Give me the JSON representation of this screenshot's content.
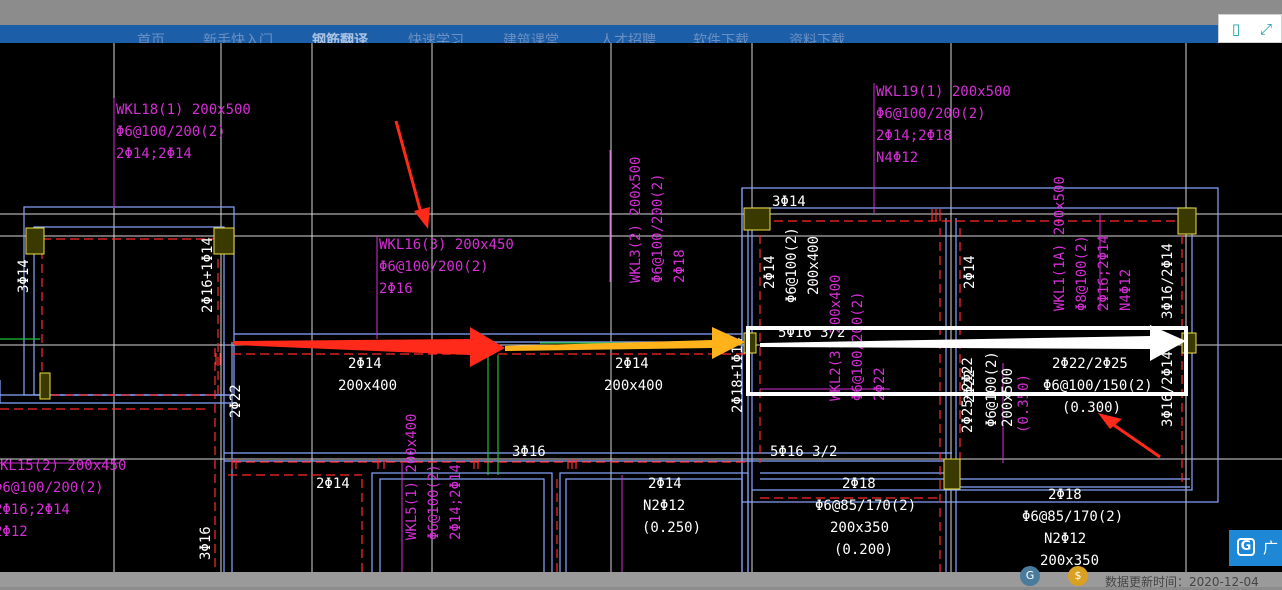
{
  "nav": {
    "items": [
      "首页",
      "新手快入门",
      "钢筋翻译",
      "快速学习",
      "建筑课堂",
      "人才招聘",
      "软件下载",
      "资料下载"
    ],
    "active_index": 2
  },
  "viewer_tools": {
    "left_icon": "tablet-icon",
    "right_icon": "expand-icon"
  },
  "footer": {
    "update_time": "数据更新时间：2020-12-04",
    "badge_left": "G",
    "badge_right": "$"
  },
  "side_widget": {
    "icon": "G",
    "text": "广"
  },
  "colors": {
    "background": "#000000",
    "beam_line": "#8aa6ff",
    "dashed_rebar": "#ff2b2b",
    "label_magenta": "#d42fd4",
    "label_white": "#ffffff",
    "column_fill": "#3a3a00",
    "column_border": "#f0e040",
    "arrow_red": "#ff2a1a",
    "arrow_orange": "#ffb21a",
    "highlight_box": "#ffffff"
  },
  "cad": {
    "labels": {
      "wkl18_title": "WKL18(1) 200x500",
      "wkl18_stirrup": "Φ6@100/200(2)",
      "wkl18_top": "2Φ14;2Φ14",
      "wkl19_title": "WKL19(1) 200x500",
      "wkl19_stirrup": "Φ6@100/200(2)",
      "wkl19_top": "2Φ14;2Φ18",
      "wkl19_n": "N4Φ12",
      "wkl16_title": "WKL16(3) 200x450",
      "wkl16_stirrup": "Φ6@100/200(2)",
      "wkl16_top": "2Φ16",
      "wkl3_title": "WKL3(2) 200x500",
      "wkl3_stirrup": "Φ6@100/200(2)",
      "wkl3_top": "2Φ18",
      "wkl15_title": "KL15(2) 200x450",
      "wkl15_stirrup": "Φ6@100/200(2)",
      "wkl15_top": "2Φ16;2Φ14",
      "wkl15_n": "2Φ12",
      "wkl1_title": "WKL1(1A) 200x500",
      "wkl1_stirrup": "Φ8@100(2)",
      "wkl1_top": "2Φ16;2Φ14",
      "wkl1_n": "N4Φ12",
      "wkl5_title": "WKL5(1) 200x400",
      "wkl5_stirrup": "Φ6@100(2)",
      "wkl5_top": "2Φ14;2Φ14",
      "kl2_title": "WKL2(3) 200x400",
      "kl2_stirrup": "Φ6@100/200(2)",
      "kl2_top": "2Φ22",
      "b_3o14_left": "3Φ14",
      "b_2o16_1o14": "2Φ16+1Φ14",
      "b_2o14_a": "2Φ14",
      "b_200x400_a": "200x400",
      "b_2o14_b": "2Φ14",
      "b_200x400_b": "200x400",
      "b_2o22_left": "2Φ22",
      "b_3o14_top": "3Φ14",
      "b_2o14_v1": "2Φ14",
      "b_o6_100": "Φ6@100(2)",
      "b_200x400_v": "200x400",
      "b_2o14_v2": "2Φ14",
      "b_3o16_2o14_top": "3Φ16/2Φ14",
      "b_5o16": "5Φ16 3/2",
      "b_2o22_2o25": "2Φ22/2Φ25",
      "b_o6_100_150": "Φ6@100/150(2)",
      "b_elev_0300": "(0.300)",
      "b_2o18_1o14": "2Φ18+1Φ14",
      "b_2o22_v": "2Φ22",
      "b_2o25_2o22": "2Φ25+2Φ22",
      "b_o6_100_v": "Φ6@100(2)",
      "b_200x500": "200x500",
      "b_elev_0350": "(0.350)",
      "b_3o16_2o14": "3Φ16/2Φ14",
      "b_3o16": "3Φ16",
      "b_5o16_b": "5Φ16 3/2",
      "b_2o14_c": "2Φ14",
      "b_2o14_d": "2Φ14",
      "b_n2o12_a": "N2Φ12",
      "b_elev_0250": "(0.250)",
      "b_2o18_a": "2Φ18",
      "b_o6_85": "Φ6@85/170(2)",
      "b_200x350": "200x350",
      "b_elev_0200": "(0.200)",
      "b_2o18_b": "2Φ18",
      "b_o6_85_b": "Φ6@85/170(2)",
      "b_n2o12_b": "N2Φ12",
      "b_200x350_b": "200x350",
      "b_3o16_bottom": "3Φ16"
    }
  }
}
